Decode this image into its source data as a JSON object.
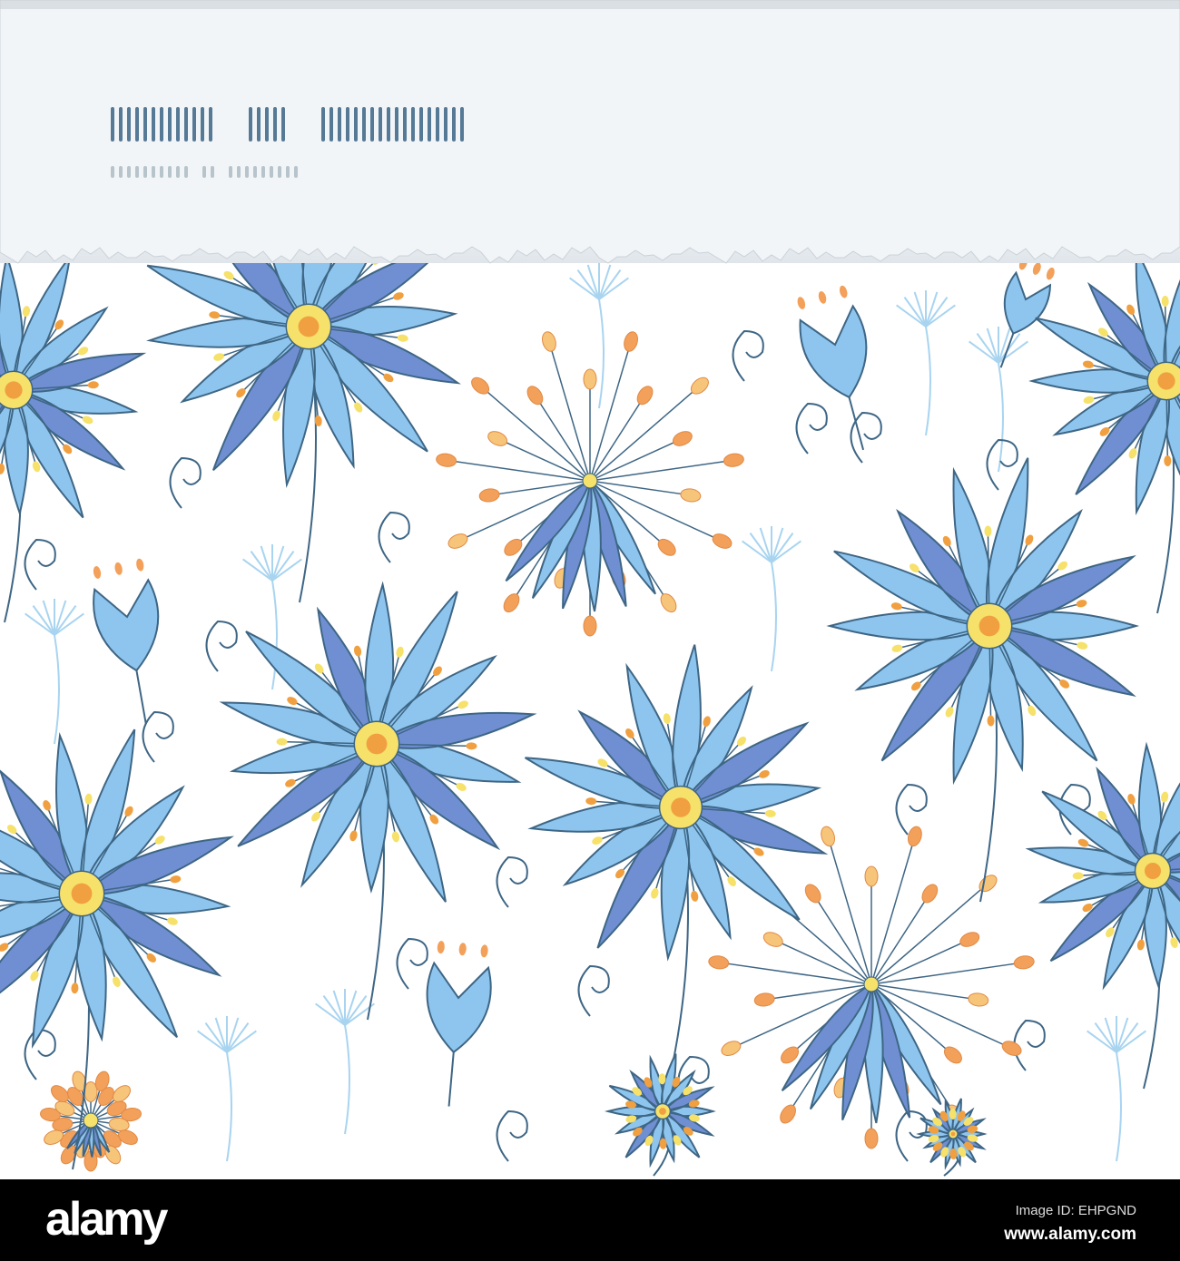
{
  "artwork": {
    "subject": "blue flowers seamless pattern with torn paper header",
    "colors": {
      "petal_light": "#8ec5ee",
      "petal_dark": "#6f8fd2",
      "stroke": "#3e6685",
      "center": "#f6e16a",
      "center_dot": "#f0a040",
      "orange": "#f3a05a",
      "pale_stem": "#a8d4f0",
      "paper": "#eef3f7"
    }
  },
  "footer": {
    "logo": "alamy",
    "image_id": "Image ID: EHPGND",
    "website": "www.alamy.com"
  }
}
